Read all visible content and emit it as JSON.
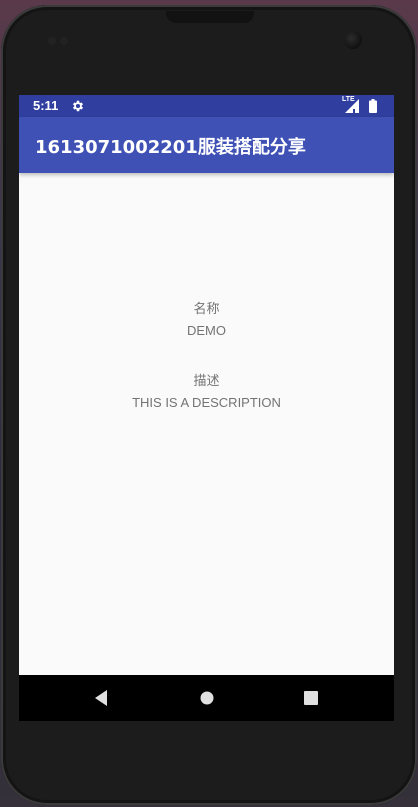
{
  "status_bar": {
    "time": "5:11",
    "network_type": "LTE",
    "settings_icon": "gear-icon",
    "signal_icon": "cell-signal-icon",
    "battery_icon": "battery-icon"
  },
  "app_bar": {
    "title": "1613071002201服装搭配分享"
  },
  "main": {
    "name_label": "名称",
    "name_value": "DEMO",
    "description_label": "描述",
    "description_value": "THIS IS A DESCRIPTION"
  },
  "navigation": {
    "back_icon": "back-triangle-icon",
    "home_icon": "home-circle-icon",
    "recents_icon": "recents-square-icon"
  },
  "colors": {
    "status_bar": "#303f9f",
    "app_bar": "#3f51b5",
    "screen_background": "#fafafa",
    "text_gray": "#737373",
    "nav_bar": "#000000"
  }
}
